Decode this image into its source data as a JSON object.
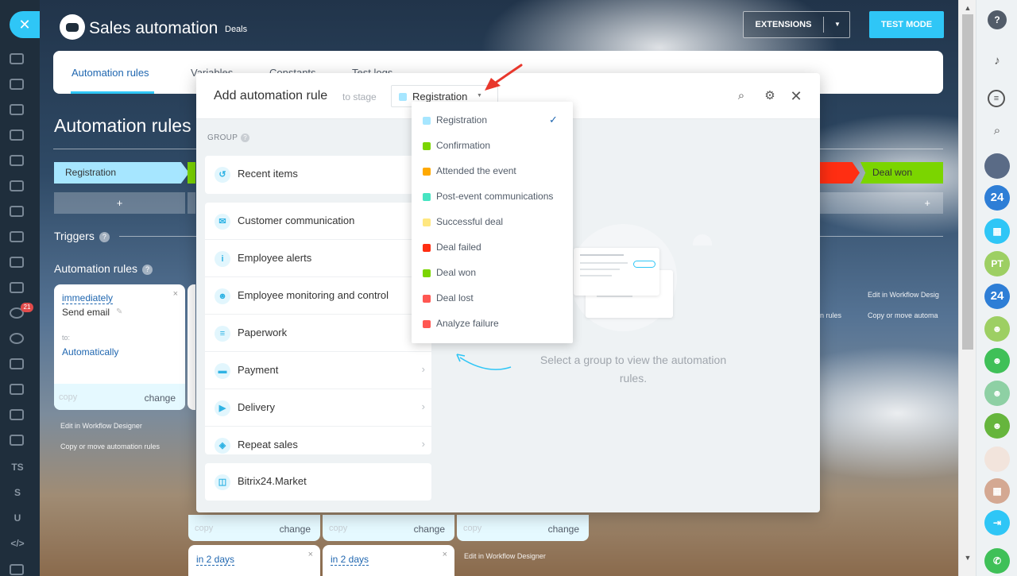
{
  "header": {
    "title": "Sales automation",
    "subtitle": "Deals",
    "extensions_label": "EXTENSIONS",
    "test_mode_label": "TEST MODE"
  },
  "tabs": [
    {
      "label": "Automation rules"
    },
    {
      "label": "Variables"
    },
    {
      "label": "Constants"
    },
    {
      "label": "Test logs"
    }
  ],
  "background": {
    "big_title": "Automation rules a",
    "stage_registration": "Registration",
    "stage_deal_won": "Deal won",
    "add_label": "+",
    "triggers_title": "Triggers",
    "rules_title": "Automation rules",
    "help": "?",
    "rule_card": {
      "when": "immediately",
      "action": "Send email",
      "to_label": "to:",
      "to_value": "Automatically",
      "copy": "copy",
      "change": "change"
    },
    "edit_designer": "Edit in Workflow Designer",
    "copy_move": "Copy or move automation rules",
    "edit_designer_short": "Edit in Workflow Desig",
    "copy_move_short": "Copy or move automa",
    "rules_short": "n rules",
    "day_card": "in 2 days",
    "close": "×"
  },
  "modal": {
    "title": "Add automation rule",
    "to_stage": "to stage",
    "selected_stage": "Registration",
    "group_label": "GROUP",
    "groups": [
      {
        "label": "Recent items",
        "icon": "clock-icon",
        "glyph": "↺"
      },
      {
        "label": "Customer communication",
        "icon": "chat-icon",
        "glyph": "✉"
      },
      {
        "label": "Employee alerts",
        "icon": "info-icon",
        "glyph": "i"
      },
      {
        "label": "Employee monitoring and control",
        "icon": "people-icon",
        "glyph": "☻"
      },
      {
        "label": "Paperwork",
        "icon": "document-icon",
        "glyph": "≡"
      },
      {
        "label": "Payment",
        "icon": "wallet-icon",
        "glyph": "▬"
      },
      {
        "label": "Delivery",
        "icon": "truck-icon",
        "glyph": "▶"
      },
      {
        "label": "Repeat sales",
        "icon": "cart-icon",
        "glyph": "◈"
      },
      {
        "label": "Bitrix24.Market",
        "icon": "market-icon",
        "glyph": "◫"
      }
    ],
    "empty_text": "Select a group to view the automation rules."
  },
  "dropdown": {
    "items": [
      {
        "label": "Registration",
        "color": "#a6e6ff",
        "selected": true
      },
      {
        "label": "Confirmation",
        "color": "#7bd500",
        "selected": false
      },
      {
        "label": "Attended the event",
        "color": "#ffa900",
        "selected": false
      },
      {
        "label": "Post-event communications",
        "color": "#47e4c2",
        "selected": false
      },
      {
        "label": "Successful deal",
        "color": "#ffe780",
        "selected": false
      },
      {
        "label": "Deal failed",
        "color": "#ff2e12",
        "selected": false
      },
      {
        "label": "Deal won",
        "color": "#7bd500",
        "selected": false
      },
      {
        "label": "Deal lost",
        "color": "#ff5752",
        "selected": false
      },
      {
        "label": "Analyze failure",
        "color": "#ff5752",
        "selected": false
      }
    ]
  },
  "left_sidebar": {
    "badge": "21",
    "ts": "TS",
    "s": "S",
    "u": "U",
    "code": "</>"
  },
  "right_sidebar": {
    "help": "?",
    "b24": "24",
    "pt": "PT"
  }
}
